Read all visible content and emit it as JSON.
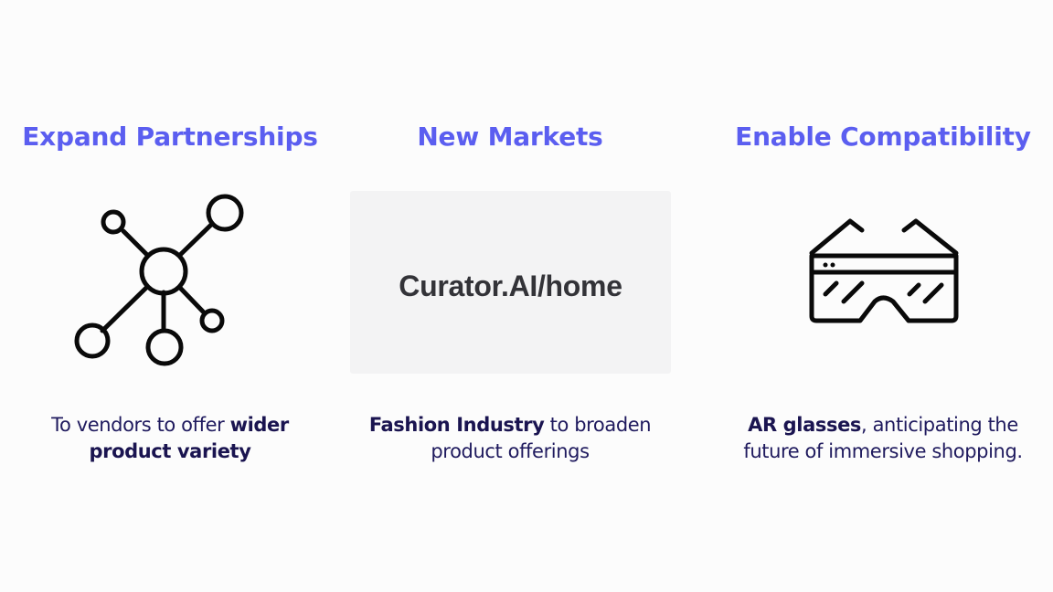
{
  "columns": [
    {
      "title": "Expand Partnerships",
      "icon": "network-nodes-icon",
      "desc_pre": "To vendors to offer ",
      "desc_bold": "wider product variety",
      "desc_post": ""
    },
    {
      "title": "New Markets",
      "card_text": "Curator.AI/home",
      "desc_pre": "",
      "desc_bold": "Fashion Industry",
      "desc_post": " to broaden product offerings"
    },
    {
      "title": "Enable Compatibility",
      "icon": "ar-glasses-icon",
      "desc_pre": "",
      "desc_bold": "AR glasses",
      "desc_post": ", anticipating the future of immersive shopping."
    }
  ],
  "colors": {
    "heading": "#5b5ef0",
    "body_text": "#1f1a5e",
    "card_bg": "#f3f3f4",
    "card_text": "#333338"
  }
}
